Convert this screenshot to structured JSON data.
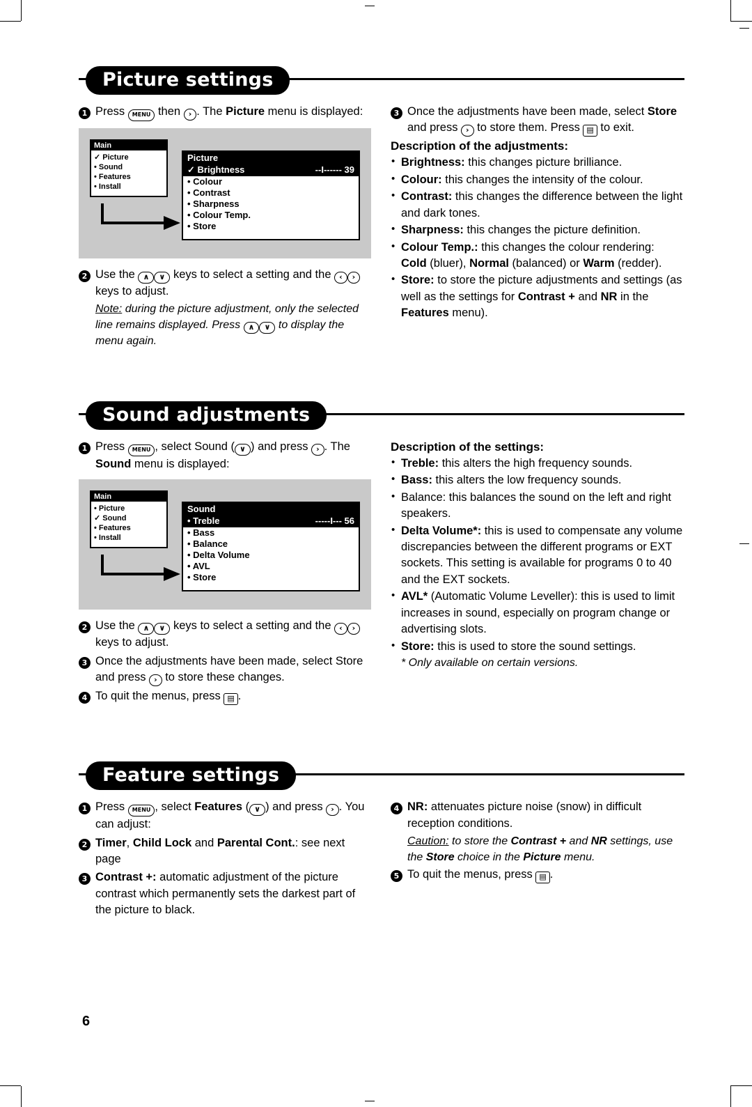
{
  "page": {
    "number": "6"
  },
  "sections": [
    {
      "title": "Picture settings",
      "left": {
        "steps": [
          {
            "num": "1",
            "text_parts": [
              "Press ",
              "MENU",
              " then ",
              ">",
              ". The ",
              "Picture",
              " menu is displayed:"
            ]
          }
        ],
        "osd": {
          "left_header": "Main",
          "left_items": [
            "Picture",
            "Sound",
            "Features",
            "Install"
          ],
          "left_selected": "Picture",
          "right_header": "Picture",
          "highlight_label": "Brightness",
          "highlight_value": "--I------ 39",
          "right_items": [
            "Colour",
            "Contrast",
            "Sharpness",
            "Colour Temp.",
            "Store"
          ]
        },
        "step2_a": "Use the",
        "step2_b": "keys to select a setting and the",
        "step2_c": "keys to adjust.",
        "note_label": "Note:",
        "note_a": " during the picture adjustment, only the selected line remains displayed. Press",
        "note_b": "to display the menu again."
      },
      "right": {
        "step3": "Once the adjustments have been made, select Store and press",
        "step3b": "to store them. Press",
        "step3c": "to exit.",
        "desc_title": "Description of the adjustments:",
        "bullets": [
          {
            "term": "Brightness:",
            "text": " this changes picture brilliance."
          },
          {
            "term": "Colour:",
            "text": " this changes the intensity of the colour."
          },
          {
            "term": "Contrast:",
            "text": " this changes the difference between the light and dark tones."
          },
          {
            "term": "Sharpness:",
            "text": " this changes the picture definition."
          },
          {
            "term": "Colour Temp.:",
            "text": " this changes the colour rendering: Cold (bluer), Normal (balanced) or Warm (redder)."
          },
          {
            "term": "Store:",
            "text": " to store the picture adjustments and settings (as well as the settings for Contrast + and NR in the Features menu)."
          }
        ]
      }
    },
    {
      "title": "Sound adjustments",
      "left": {
        "step1_a": "Press",
        "step1_b": ", select Sound (",
        "step1_c": ") and press",
        "step1_d": ". The Sound menu is displayed:",
        "osd": {
          "left_header": "Main",
          "left_items": [
            "Picture",
            "Sound",
            "Features",
            "Install"
          ],
          "left_selected": "Sound",
          "right_header": "Sound",
          "highlight_label": "Treble",
          "highlight_value": "-----I--- 56",
          "right_items": [
            "Bass",
            "Balance",
            "Delta Volume",
            "AVL",
            "Store"
          ]
        },
        "step2_a": "Use the",
        "step2_b": "keys to select a setting and the",
        "step2_c": "keys to adjust.",
        "step3_a": "Once the adjustments have been made, select Store and press",
        "step3_b": "to store these changes.",
        "step4_a": "To quit the menus, press",
        "step4_b": "."
      },
      "right": {
        "desc_title": "Description of the settings:",
        "bullets": [
          {
            "term": "Treble:",
            "text": " this alters the high frequency sounds."
          },
          {
            "term": "Bass:",
            "text": " this alters the low frequency sounds."
          },
          {
            "term": "Balance:",
            "text": " this balances the sound on the left and right speakers."
          },
          {
            "term": "Delta Volume*:",
            "text": " this is used to compensate any volume discrepancies between the different programs or EXT sockets. This setting is available for programs 0 to 40 and the EXT sockets."
          },
          {
            "term": "AVL*",
            "text": " (Automatic Volume Leveller): this is used to limit increases in sound, especially on program change or advertising slots."
          },
          {
            "term": "Store:",
            "text": " this is used to store the sound settings."
          }
        ],
        "footnote": "* Only available on certain versions."
      }
    },
    {
      "title": "Feature settings",
      "left": {
        "step1_a": "Press",
        "step1_b": ", select",
        "step1_c": "Features",
        "step1_d": "(",
        "step1_e": ") and press",
        "step1_f": ". You can adjust:",
        "step2": "Timer, Child Lock and Parental Cont.: see next page",
        "step3_term": "Contrast +:",
        "step3_text": " automatic adjustment of the picture contrast which permanently sets the darkest part of the picture to black."
      },
      "right": {
        "step4_term": "NR:",
        "step4_text": " attenuates picture noise (snow) in difficult reception conditions.",
        "caution_label": "Caution:",
        "caution_text": " to store the Contrast + and NR settings, use the Store choice in the Picture menu.",
        "step5_a": "To quit the menus, press",
        "step5_b": "."
      }
    }
  ],
  "keys": {
    "menu": "MENU",
    "right": "›",
    "left": "‹",
    "up": "∧",
    "down": "∨",
    "exit": "▤"
  }
}
